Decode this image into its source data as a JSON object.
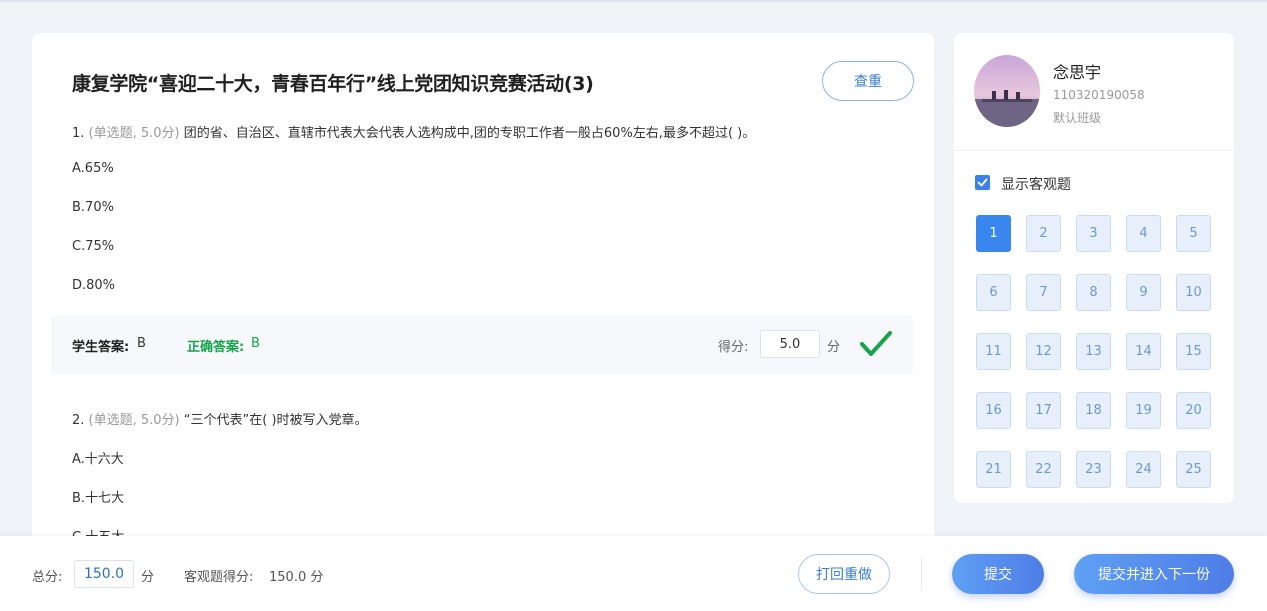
{
  "title": "康复学院“喜迎二十大，青春百年行”线上党团知识竞赛活动(3)",
  "recheck_label": "查重",
  "questions": [
    {
      "number": "1.",
      "meta": "(单选题, 5.0分)",
      "text": "团的省、自治区、直辖市代表大会代表人选构成中,团的专职工作者一般占60%左右,最多不超过( )。",
      "options": [
        "A.65%",
        "B.70%",
        "C.75%",
        "D.80%"
      ]
    },
    {
      "number": "2.",
      "meta": "(单选题, 5.0分)",
      "text": "“三个代表”在( )时被写入党章。",
      "options": [
        "A.十六大",
        "B.十七大",
        "C.十五大"
      ]
    }
  ],
  "answer": {
    "student_label": "学生答案:",
    "student_value": "B",
    "correct_label": "正确答案:",
    "correct_value": "B",
    "score_label": "得分:",
    "score_value": "5.0",
    "score_unit": "分",
    "result_icon": "check-icon",
    "result_color": "#17a34a"
  },
  "user": {
    "name": "念思宇",
    "id": "110320190058",
    "class": "默认班级"
  },
  "show_objective": {
    "label": "显示客观题",
    "checked": true
  },
  "question_numbers": [
    "1",
    "2",
    "3",
    "4",
    "5",
    "6",
    "7",
    "8",
    "9",
    "10",
    "11",
    "12",
    "13",
    "14",
    "15",
    "16",
    "17",
    "18",
    "19",
    "20",
    "21",
    "22",
    "23",
    "24",
    "25"
  ],
  "active_question": "1",
  "bottom": {
    "total_label": "总分:",
    "total_value": "150.0",
    "total_unit": "分",
    "objective_label": "客观题得分:",
    "objective_value": "150.0 分",
    "redo_label": "打回重做",
    "submit_label": "提交",
    "submit_next_label": "提交并进入下一份"
  },
  "colors": {
    "accent": "#3a86ef",
    "correct": "#17a34a",
    "background": "#f0f3f7"
  }
}
